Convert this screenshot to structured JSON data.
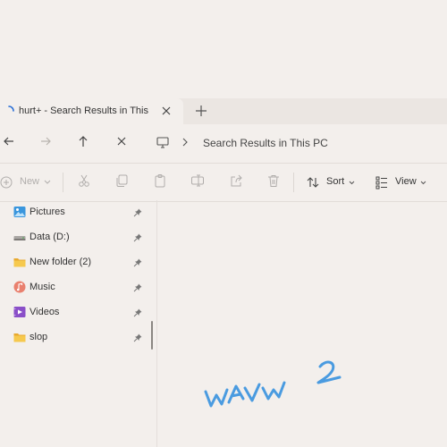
{
  "tab": {
    "title": "hurt+ - Search Results in This P"
  },
  "address": {
    "breadcrumb": "Search Results in This PC"
  },
  "command_bar": {
    "new_label": "New",
    "sort_label": "Sort",
    "view_label": "View"
  },
  "sidebar": {
    "items": [
      {
        "label": "Pictures",
        "icon": "pictures-icon"
      },
      {
        "label": "Data (D:)",
        "icon": "drive-icon"
      },
      {
        "label": "New folder (2)",
        "icon": "folder-icon"
      },
      {
        "label": "Music",
        "icon": "music-icon"
      },
      {
        "label": "Videos",
        "icon": "videos-icon"
      },
      {
        "label": "slop",
        "icon": "folder-icon"
      }
    ]
  },
  "scribble": {
    "text": "WAVW 2",
    "color": "#4a9be0"
  },
  "colors": {
    "background": "#f3efec",
    "tabstrip": "#ebe6e2",
    "folder": "#f2c14e"
  }
}
